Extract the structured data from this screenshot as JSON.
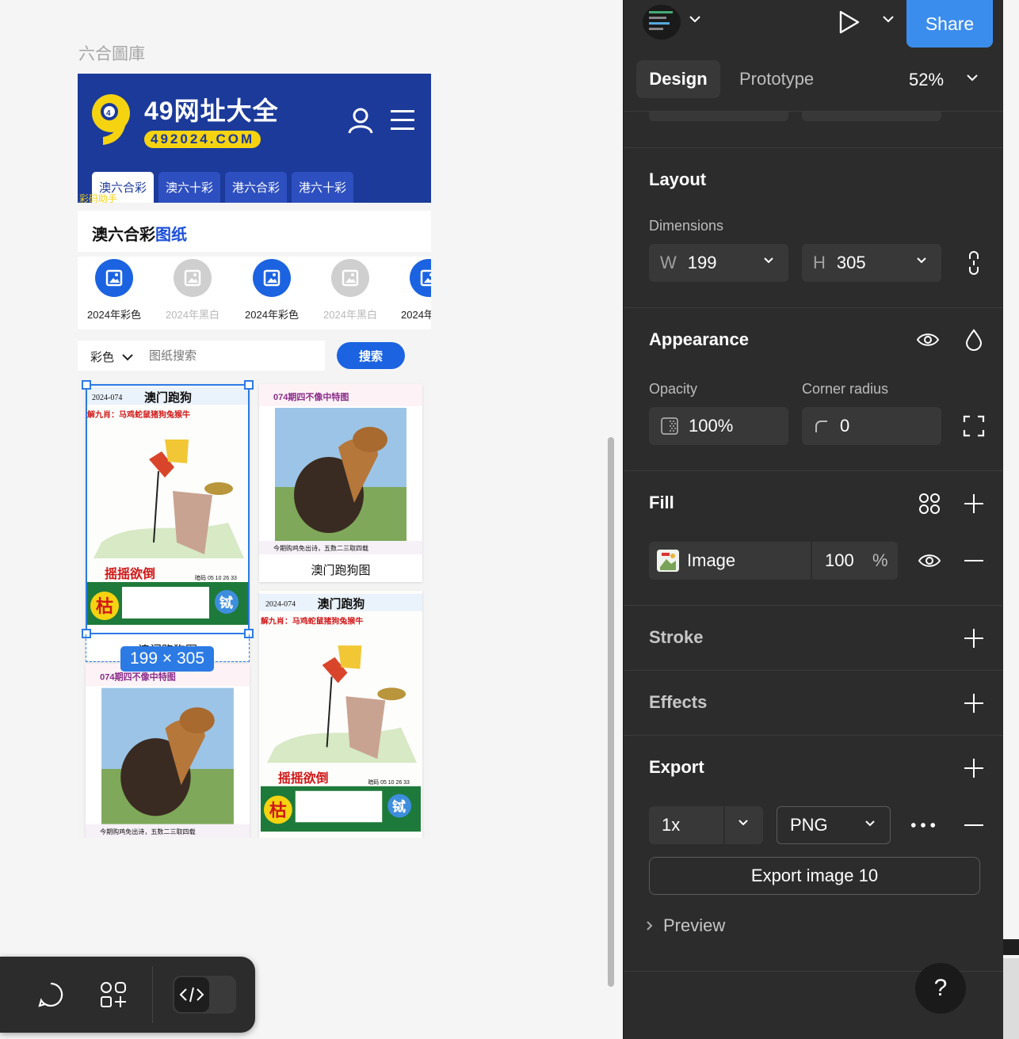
{
  "canvas": {
    "frame_title": "六合圖庫",
    "site": {
      "logo_title": "49网址大全",
      "logo_url": "492024.COM",
      "logo_number": "9",
      "tabs": [
        "澳六合彩",
        "澳六十彩",
        "港六合彩",
        "港六十彩"
      ],
      "ticker": "彩码助手",
      "section_title_a": "澳六合彩",
      "section_title_b": "图纸",
      "categories": [
        {
          "label": "2024年彩色",
          "style": "blue"
        },
        {
          "label": "2024年黑白",
          "style": "gray"
        },
        {
          "label": "2024年彩色",
          "style": "blue"
        },
        {
          "label": "2024年黑白",
          "style": "gray"
        },
        {
          "label": "2024年",
          "style": "blue"
        }
      ],
      "search": {
        "select_value": "彩色",
        "placeholder": "图纸搜索",
        "button": "搜索"
      },
      "cards": [
        {
          "caption": "澳门跑狗图",
          "poster": "dog"
        },
        {
          "caption": "澳门跑狗图",
          "poster": "rooster"
        },
        {
          "caption": "",
          "poster": "rooster"
        },
        {
          "caption": "",
          "poster": "dog"
        }
      ],
      "poster_text": {
        "date": "2024-074",
        "title": "澳门跑狗",
        "zodiac_line": "解九肖：马鸡蛇鼠猪狗兔猴牛",
        "phrase": "摇摇欲倒",
        "code": "暗码 05 10 26 33",
        "big_char": "枯",
        "seal_char": "铽",
        "rooster_head": "074期四不像中特图",
        "rooster_footer": "今期购鸡免出诗，五数二三取四载"
      }
    },
    "selection_size": "199 × 305"
  },
  "toolbar": {
    "comment_icon": "comment-icon",
    "assets_icon": "assets-icon",
    "dev_icon": "code-icon"
  },
  "panel": {
    "share": "Share",
    "tabs": {
      "design": "Design",
      "prototype": "Prototype"
    },
    "zoom": "52%",
    "layout": {
      "title": "Layout",
      "dimensions_label": "Dimensions",
      "w_prefix": "W",
      "w_value": "199",
      "h_prefix": "H",
      "h_value": "305"
    },
    "appearance": {
      "title": "Appearance",
      "opacity_label": "Opacity",
      "opacity_value": "100%",
      "radius_label": "Corner radius",
      "radius_value": "0"
    },
    "fill": {
      "title": "Fill",
      "type": "Image",
      "opacity": "100",
      "unit": "%"
    },
    "stroke": {
      "title": "Stroke"
    },
    "effects": {
      "title": "Effects"
    },
    "export": {
      "title": "Export",
      "scale": "1x",
      "format": "PNG",
      "button": "Export image 10",
      "preview": "Preview"
    },
    "help": "?"
  },
  "colors": {
    "site_blue": "#1b3a9a",
    "accent_blue": "#1b63e0",
    "selection_blue": "#2c7be5",
    "share_blue": "#3b8ded",
    "panel_bg": "#2c2c2c"
  }
}
